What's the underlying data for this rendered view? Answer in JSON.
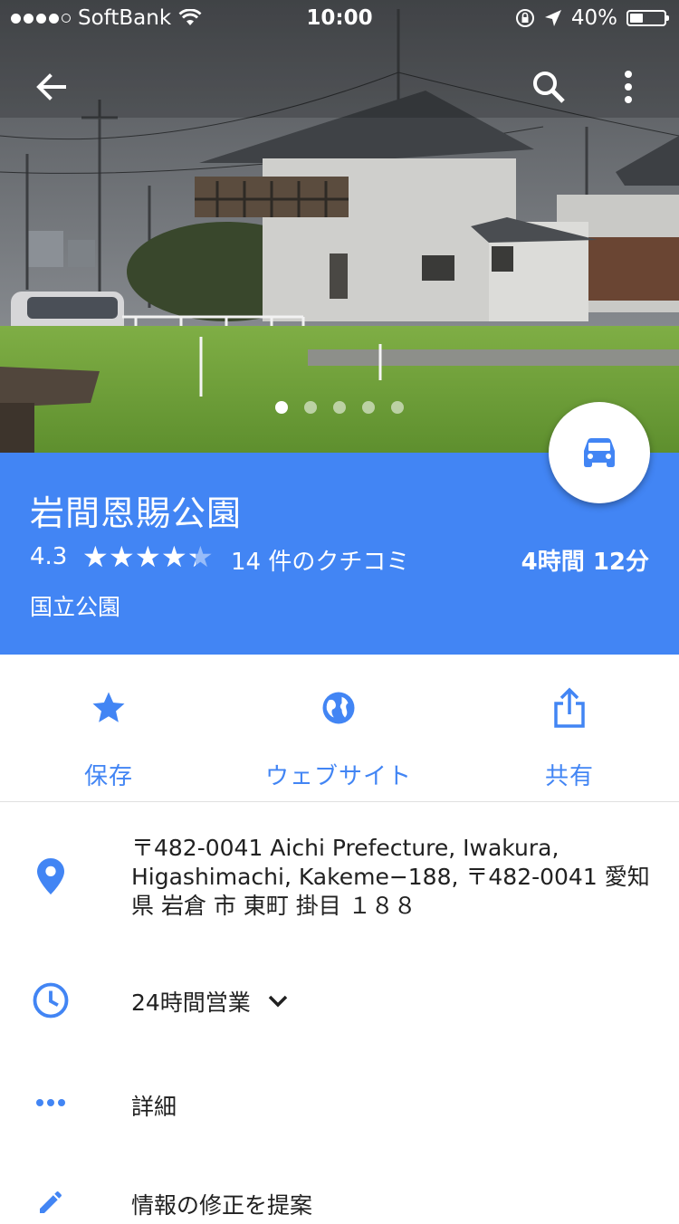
{
  "status_bar": {
    "carrier": "SoftBank",
    "time": "10:00",
    "battery": "40%",
    "battery_level": 0.4
  },
  "hero": {
    "photo_count": 5,
    "active_photo": 1
  },
  "place": {
    "name": "岩間恩賜公園",
    "rating": "4.3",
    "rating_value": 4.3,
    "reviews": "14 件のクチコミ",
    "drive_time": "4時間 12分",
    "category": "国立公園"
  },
  "actions": {
    "save": "保存",
    "website": "ウェブサイト",
    "share": "共有"
  },
  "details": {
    "address": "〒482-0041 Aichi Prefecture, Iwakura, Higashimachi, Kakeme−188, 〒482-0041 愛知県 岩倉 市 東町 掛目 １８８",
    "hours": "24時間営業",
    "more": "詳細",
    "suggest_edit": "情報の修正を提案"
  },
  "colors": {
    "accent": "#4285f4"
  }
}
